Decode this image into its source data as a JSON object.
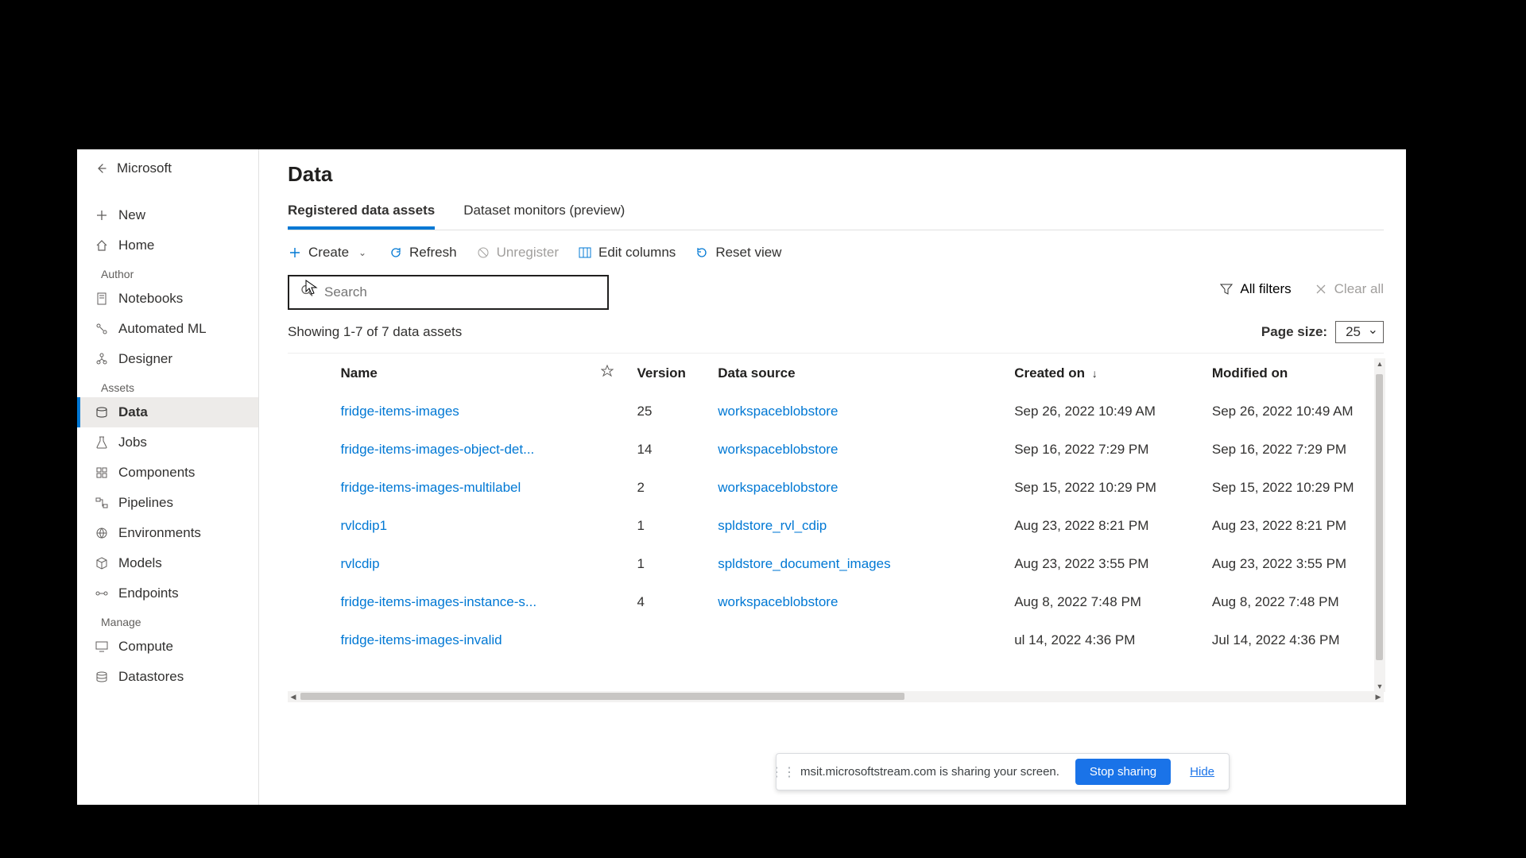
{
  "sidebar": {
    "brand": "Microsoft",
    "new": "New",
    "home": "Home",
    "sections": {
      "author": "Author",
      "assets": "Assets",
      "manage": "Manage"
    },
    "items": {
      "notebooks": "Notebooks",
      "automated_ml": "Automated ML",
      "designer": "Designer",
      "data": "Data",
      "jobs": "Jobs",
      "components": "Components",
      "pipelines": "Pipelines",
      "environments": "Environments",
      "models": "Models",
      "endpoints": "Endpoints",
      "compute": "Compute",
      "datastores": "Datastores"
    }
  },
  "header": {
    "title": "Data"
  },
  "tabs": {
    "registered": "Registered data assets",
    "monitors": "Dataset monitors (preview)"
  },
  "toolbar": {
    "create": "Create",
    "refresh": "Refresh",
    "unregister": "Unregister",
    "edit_columns": "Edit columns",
    "reset_view": "Reset view"
  },
  "search": {
    "placeholder": "Search"
  },
  "filters": {
    "all": "All filters",
    "clear": "Clear all"
  },
  "meta": {
    "showing": "Showing 1-7 of 7 data assets"
  },
  "page_size": {
    "label": "Page size:",
    "value": "25"
  },
  "columns": {
    "name": "Name",
    "version": "Version",
    "data_source": "Data source",
    "created_on": "Created on",
    "modified_on": "Modified on"
  },
  "rows": [
    {
      "name": "fridge-items-images",
      "version": "25",
      "source": "workspaceblobstore",
      "created": "Sep 26, 2022 10:49 AM",
      "modified": "Sep 26, 2022 10:49 AM"
    },
    {
      "name": "fridge-items-images-object-det...",
      "version": "14",
      "source": "workspaceblobstore",
      "created": "Sep 16, 2022 7:29 PM",
      "modified": "Sep 16, 2022 7:29 PM"
    },
    {
      "name": "fridge-items-images-multilabel",
      "version": "2",
      "source": "workspaceblobstore",
      "created": "Sep 15, 2022 10:29 PM",
      "modified": "Sep 15, 2022 10:29 PM"
    },
    {
      "name": "rvlcdip1",
      "version": "1",
      "source": "spldstore_rvl_cdip",
      "created": "Aug 23, 2022 8:21 PM",
      "modified": "Aug 23, 2022 8:21 PM"
    },
    {
      "name": "rvlcdip",
      "version": "1",
      "source": "spldstore_document_images",
      "created": "Aug 23, 2022 3:55 PM",
      "modified": "Aug 23, 2022 3:55 PM"
    },
    {
      "name": "fridge-items-images-instance-s...",
      "version": "4",
      "source": "workspaceblobstore",
      "created": "Aug 8, 2022 7:48 PM",
      "modified": "Aug 8, 2022 7:48 PM"
    },
    {
      "name": "fridge-items-images-invalid",
      "version": "",
      "source": "",
      "created": "ul 14, 2022 4:36 PM",
      "modified": "Jul 14, 2022 4:36 PM"
    }
  ],
  "share_banner": {
    "message": "msit.microsoftstream.com is sharing your screen.",
    "stop": "Stop sharing",
    "hide": "Hide"
  }
}
